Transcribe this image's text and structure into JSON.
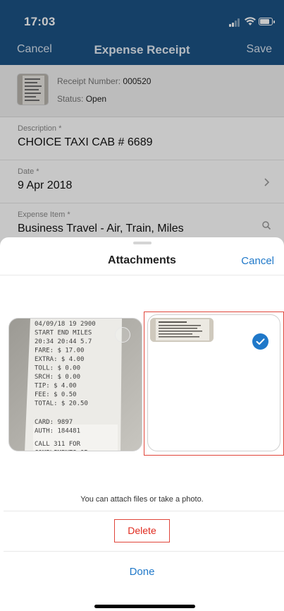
{
  "status_bar": {
    "time": "17:03"
  },
  "navbar": {
    "cancel_label": "Cancel",
    "title": "Expense Receipt",
    "save_label": "Save"
  },
  "receipt": {
    "number_label": "Receipt Number:",
    "number_value": "000520",
    "status_label": "Status:",
    "status_value": "Open"
  },
  "form": {
    "description": {
      "label": "Description *",
      "value": "CHOICE TAXI CAB # 6689"
    },
    "date": {
      "label": "Date *",
      "value": "9 Apr 2018"
    },
    "expense_item": {
      "label": "Expense Item *",
      "value": "Business Travel - Air, Train, Miles"
    }
  },
  "sheet": {
    "title": "Attachments",
    "cancel_label": "Cancel",
    "helper_text": "You can attach files or take a photo.",
    "delete_label": "Delete",
    "done_label": "Done"
  },
  "receipt_thumbnail_lines": [
    "04/09/18 19 2900",
    "START END MILES",
    "20:34 20:44 5.7",
    "FARE: $ 17.00",
    "EXTRA: $ 4.00",
    "TOLL: $ 0.00",
    "SRCH: $ 0.00",
    "TIP: $ 4.00",
    "FEE: $ 0.50",
    "TOTAL: $ 20.50",
    "CARD: 9897",
    "AUTH: 184481",
    "CALL 311 FOR",
    "COMPLIMENTS OR"
  ],
  "colors": {
    "nav_blue": "#1b5285",
    "accent_blue": "#1f78c9",
    "delete_red": "#e02a1e"
  }
}
